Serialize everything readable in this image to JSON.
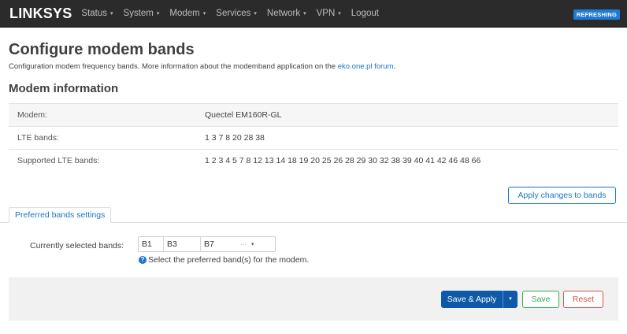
{
  "navbar": {
    "brand": "LINKSYS",
    "menu": [
      {
        "label": "Status"
      },
      {
        "label": "System"
      },
      {
        "label": "Modem"
      },
      {
        "label": "Services"
      },
      {
        "label": "Network"
      },
      {
        "label": "VPN"
      }
    ],
    "logout": "Logout",
    "refresh_badge": "REFRESHING",
    "caret_glyph": "▾"
  },
  "page": {
    "title": "Configure modem bands",
    "description_prefix": "Configuration modem frequency bands. More information about the modemband application on the ",
    "description_link": "eko.one.pl forum",
    "description_suffix": "."
  },
  "modem_info": {
    "section_title": "Modem information",
    "rows": [
      {
        "key": "Modem:",
        "value": "Quectel EM160R-GL"
      },
      {
        "key": "LTE bands:",
        "value": "1 3 7 8 20 28 38"
      },
      {
        "key": "Supported LTE bands:",
        "value": "1 2 3 4 5 7 8 12 13 14 18 19 20 25 26 28 29 30 32 38 39 40 41 42 46 48 66"
      }
    ]
  },
  "apply_bands_button": "Apply changes to bands",
  "tabs": {
    "preferred": "Preferred bands settings"
  },
  "bands_field": {
    "label": "Currently selected bands:",
    "selected": [
      "B1",
      "B3",
      "B7"
    ],
    "more_glyph": "···",
    "caret_glyph": "▾",
    "help_icon_glyph": "?",
    "help_text": "Select the preferred band(s) for the modem."
  },
  "footer": {
    "save_apply": "Save & Apply",
    "save_apply_caret": "▾",
    "save": "Save",
    "reset": "Reset"
  },
  "colors": {
    "navbar_bg": "#2b2b2b",
    "accent_blue": "#1b76c7",
    "primary_button": "#0e5aa8",
    "save_green": "#2fae54",
    "reset_red": "#d9534f"
  }
}
